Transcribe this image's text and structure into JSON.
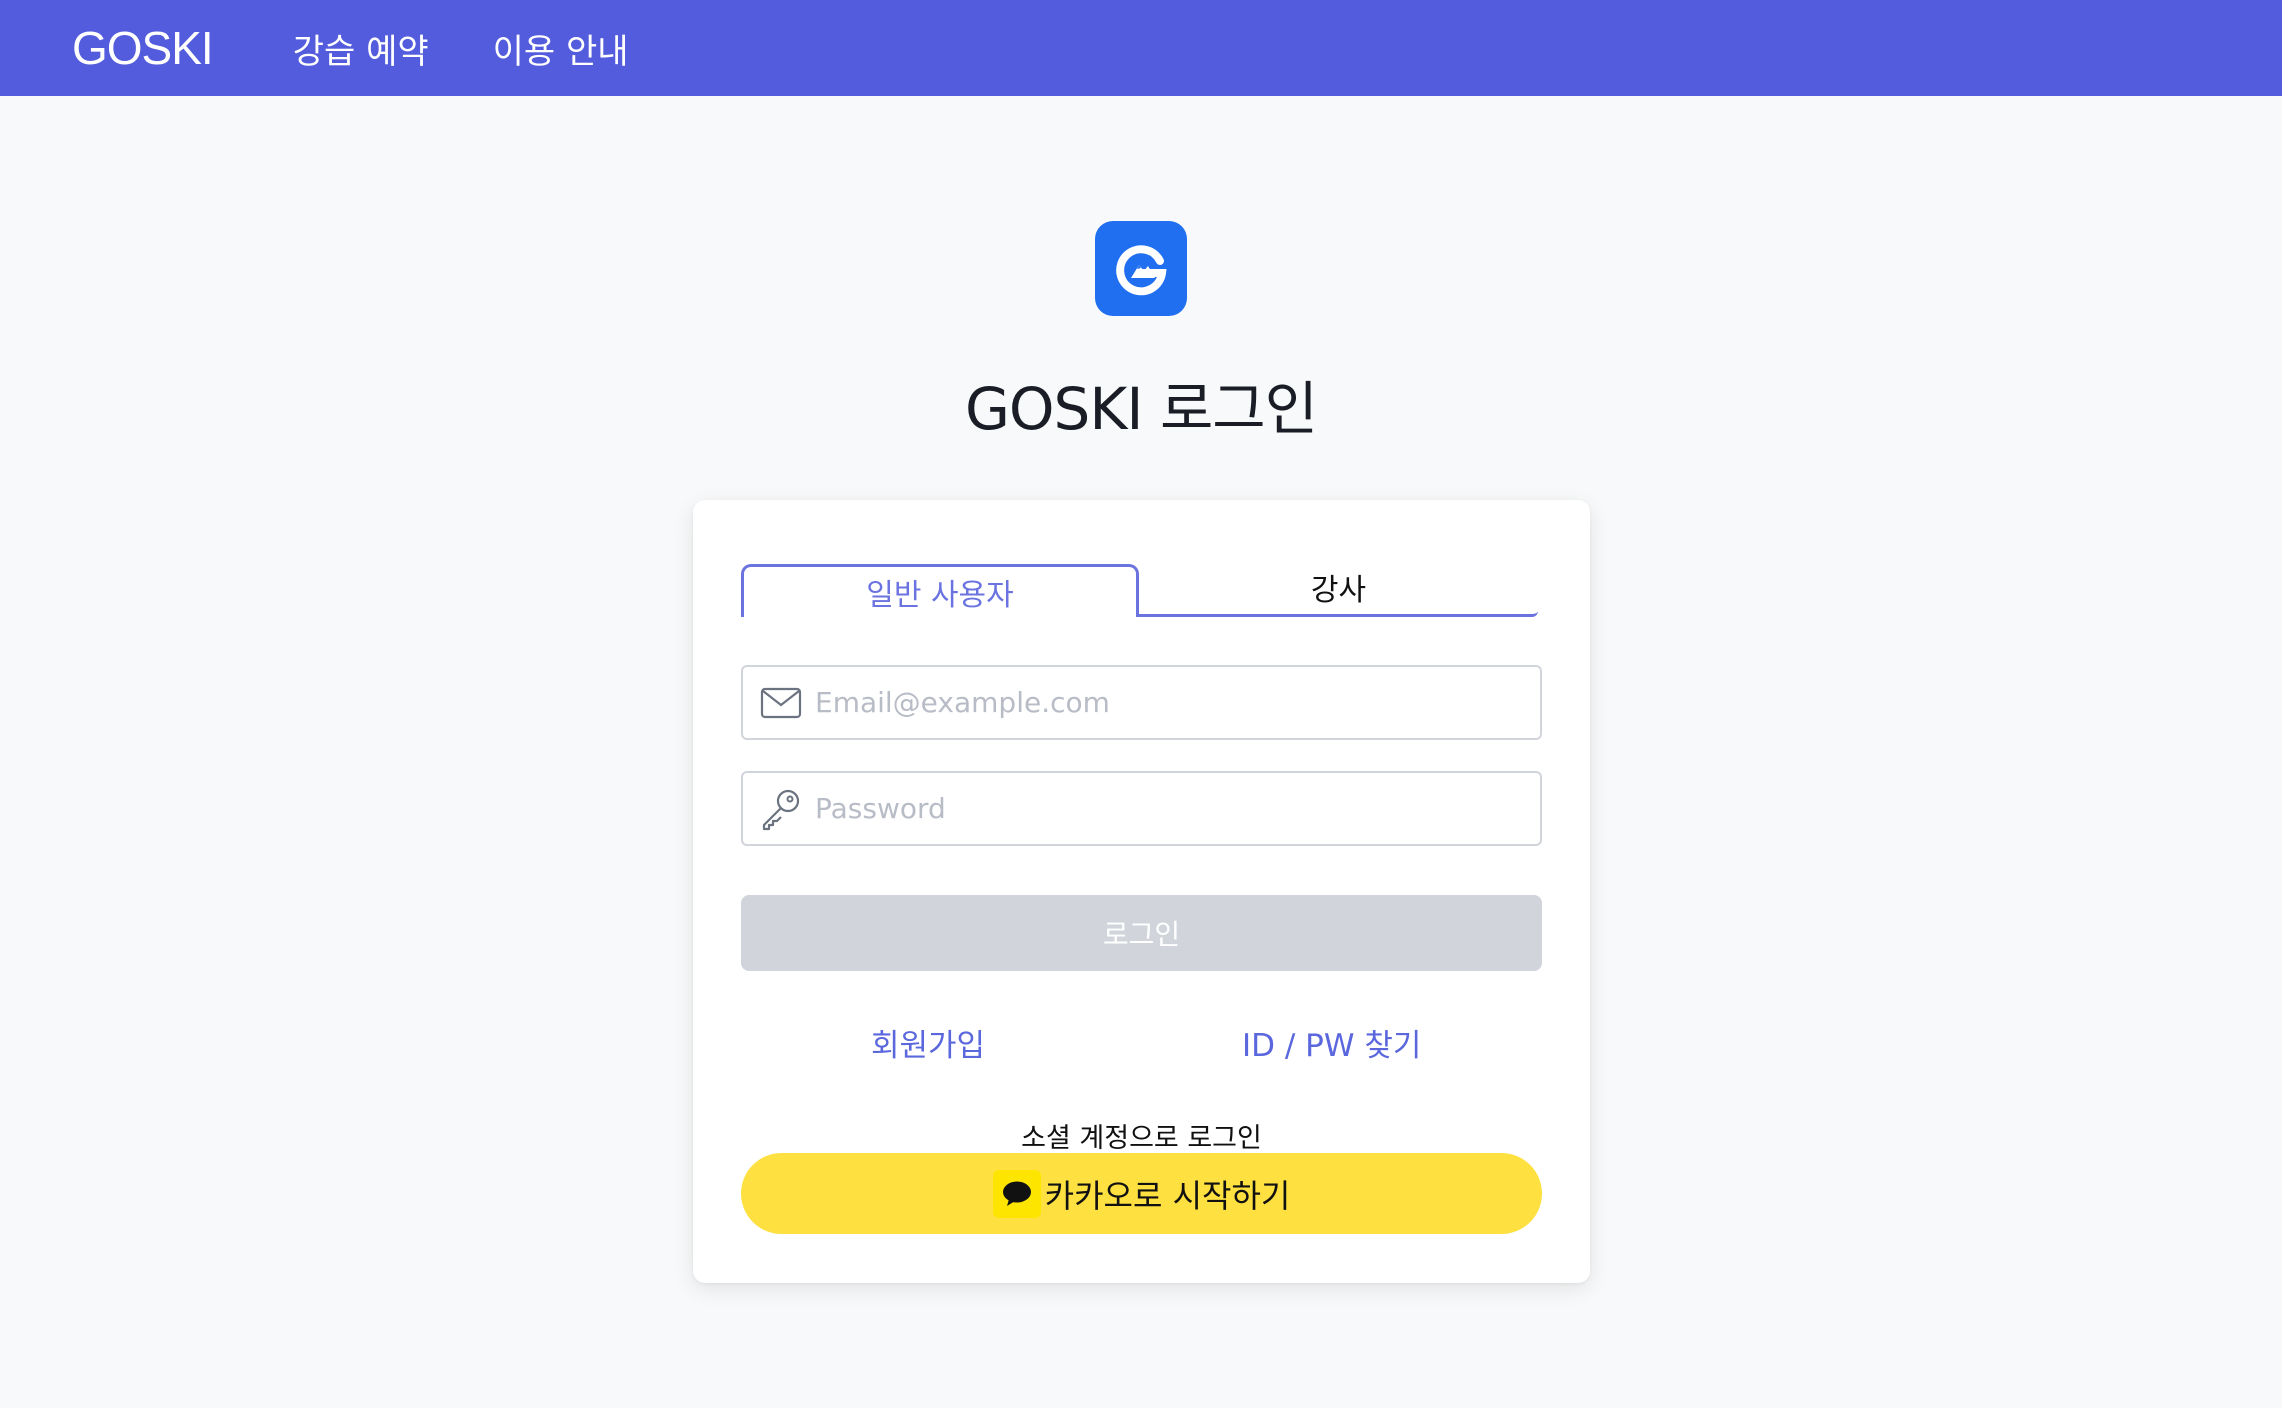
{
  "nav": {
    "brand": "GOSKI",
    "links": [
      "강습 예약",
      "이용 안내"
    ]
  },
  "page": {
    "title": "GOSKI 로그인",
    "logo_icon": "goski-logo-icon"
  },
  "tabs": {
    "user": "일반 사용자",
    "instructor": "강사",
    "active": "user"
  },
  "form": {
    "email": {
      "placeholder": "Email@example.com",
      "value": "",
      "icon": "envelope-icon"
    },
    "password": {
      "placeholder": "Password",
      "value": "",
      "icon": "key-icon"
    },
    "login_label": "로그인"
  },
  "links": {
    "signup": "회원가입",
    "find": "ID / PW 찾기"
  },
  "social": {
    "label": "소셜 계정으로 로그인",
    "kakao_label": "카카오로 시작하기",
    "kakao_icon": "kakao-speech-bubble-icon"
  },
  "colors": {
    "nav_bg": "#525cdc",
    "accent": "#6b73e0",
    "logo_bg": "#1f6ff0",
    "disabled_button": "#d1d5db",
    "kakao_yellow": "#fee040"
  }
}
